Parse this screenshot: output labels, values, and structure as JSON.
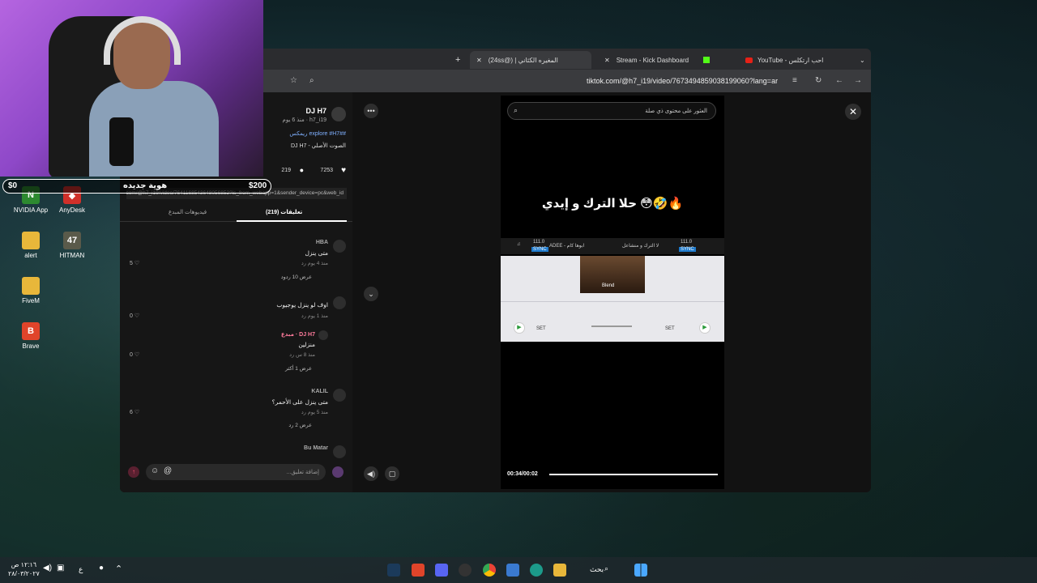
{
  "webcam": {
    "money_left": "$0",
    "money_right": "$200",
    "overlay_text": "هوية جديده"
  },
  "desktop_icons": [
    {
      "label": "NVIDIA App",
      "glyph": "N",
      "color": "#2d8a30"
    },
    {
      "label": "AnyDesk",
      "glyph": "◆",
      "color": "#d0302a"
    },
    {
      "label": "alert",
      "glyph": "",
      "color": "#e8b73a"
    },
    {
      "label": "HITMAN",
      "glyph": "47",
      "color": "#5a5a4a"
    },
    {
      "label": "FiveM",
      "glyph": "",
      "color": "#e8b73a"
    },
    {
      "label": "Brave",
      "glyph": "B",
      "color": "#e0442a"
    }
  ],
  "tabs": [
    {
      "label": "YouTube - احب ارتكلس",
      "active": false
    },
    {
      "label": "Stream - Kick Dashboard",
      "active": false
    },
    {
      "label": "المغيره الكثاني | (@24ss)",
      "active": true
    }
  ],
  "url": "tiktok.com/@h7_i19/video/7673494859038199060?lang=ar",
  "profile": {
    "name": "DJ H7",
    "handle": "h7_i19 · منذ 6 يوم",
    "desc": "#explore #H7# ريمكس",
    "sound": "الصوت الأصلي - DJ H7",
    "likes": "7253",
    "comments": "219",
    "link": "https://www.tiktok.com/@h7_i19/video/7641168543648056852?is_from_webapp=1&sender_device=pc&web_id"
  },
  "comment_tabs": {
    "comments": "تعليقات (219)",
    "creator_videos": "فيديوهات المبدع"
  },
  "comments": [
    {
      "name": "HBA",
      "text": "متى ينزل",
      "meta": "منذ 4 يوم   رد",
      "likes": "5",
      "replies": "عرض 10 ردود"
    },
    {
      "name": "",
      "text": "اوف لو ينزل يوجيوب",
      "meta": "منذ 1 يوم   رد",
      "likes": "0",
      "replies": ""
    },
    {
      "name": "DJ H7 · مبدع",
      "text": "منزلين",
      "meta": "منذ 8 س   رد",
      "likes": "0",
      "replies": "عرض 1 أكثر"
    },
    {
      "name": "KALIL",
      "text": "متى ينزل على الأحمر؟",
      "meta": "منذ 5 يوم   رد",
      "likes": "6",
      "replies": "عرض 2 رد"
    },
    {
      "name": "Bu Matar",
      "text": "",
      "meta": "",
      "likes": "",
      "replies": ""
    }
  ],
  "comment_input_placeholder": "إضافة تعليق...",
  "video": {
    "search_placeholder": "العثور على محتوى ذي صلة",
    "caption": "حلا الترك و إيدي 😳🤣🔥",
    "time": "00:34/00:02",
    "progress": 1.0,
    "deck": {
      "bpm_left": "111.0",
      "bpm_right": "111.0",
      "track_left": "ADEE - ابوها كام",
      "track_right": "لا الترك و منشاعل",
      "blend_label": "Blend",
      "set_label": "SET",
      "sync_label": "SYNC"
    }
  },
  "taskbar": {
    "search_label": "بحث",
    "clock_time": "١٢:١٦ ص",
    "clock_date": "٢٨/٠٣/٢٠٢٧",
    "lang": "ع"
  }
}
